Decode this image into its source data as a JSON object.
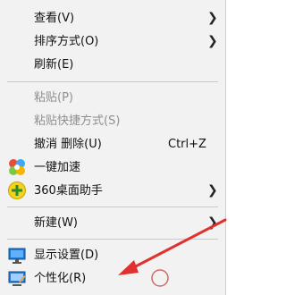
{
  "menu": {
    "items": [
      {
        "label": "查看(V)",
        "has_submenu": true
      },
      {
        "label": "排序方式(O)",
        "has_submenu": true
      },
      {
        "label": "刷新(E)"
      },
      {
        "label": "粘贴(P)",
        "disabled": true
      },
      {
        "label": "粘贴快捷方式(S)",
        "disabled": true
      },
      {
        "label": "撤消 删除(U)",
        "shortcut": "Ctrl+Z"
      },
      {
        "label": "一键加速",
        "icon": "speed-boost-icon"
      },
      {
        "label": "360桌面助手",
        "icon": "360-plus-icon",
        "has_submenu": true
      },
      {
        "label": "新建(W)",
        "has_submenu": true
      },
      {
        "label": "显示设置(D)",
        "icon": "display-settings-icon"
      },
      {
        "label": "个性化(R)",
        "icon": "personalize-icon"
      }
    ]
  },
  "annotation": {
    "arrow_color": "#e03030"
  }
}
